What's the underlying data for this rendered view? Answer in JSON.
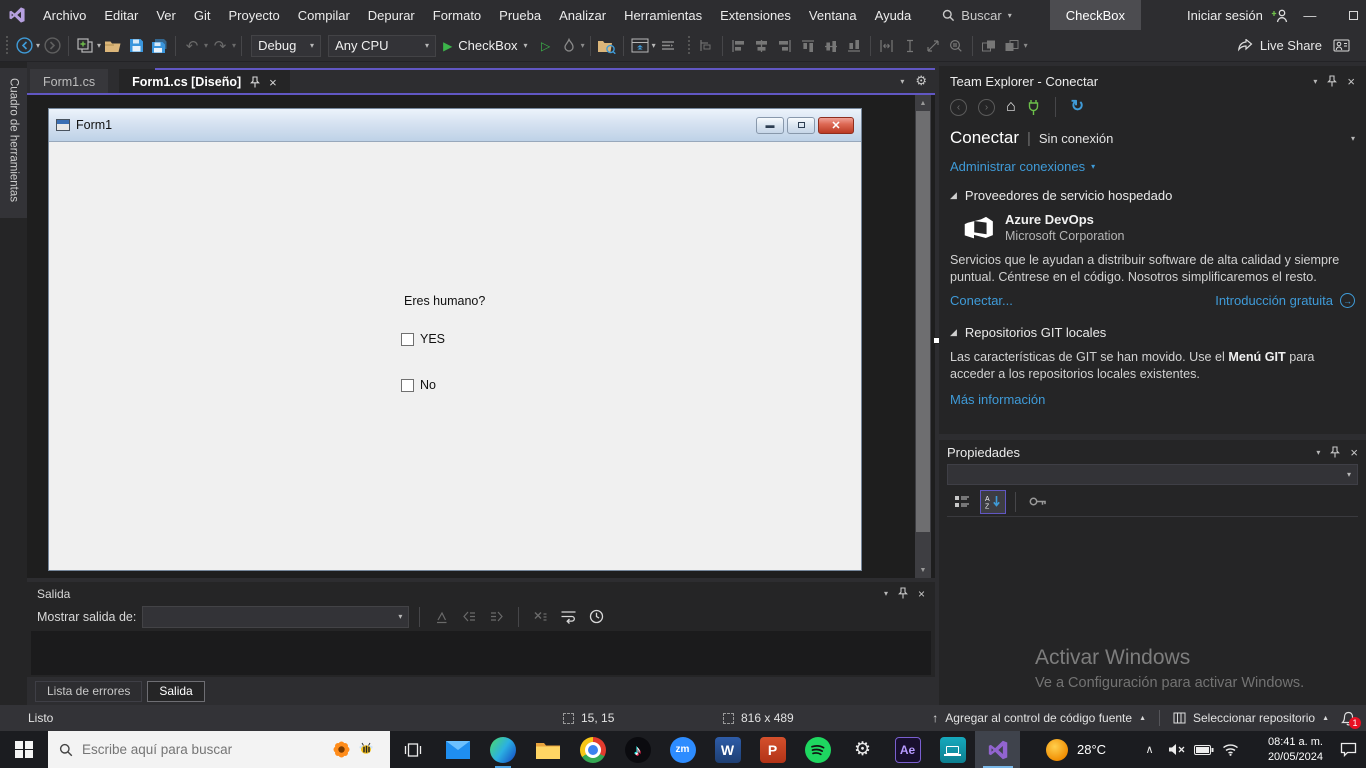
{
  "icons": {
    "search-icon": "magnifier",
    "dropdown-caret": "▾",
    "close-icon": "×",
    "pin-icon": "pushpin",
    "expander-icon": "◢",
    "home-icon": "⌂",
    "refresh-icon": "↻",
    "gear-icon": "⚙",
    "play-icon": "▶",
    "arrow-up-icon": "↑"
  },
  "colors": {
    "accent_purple": "#6157c3",
    "link_blue": "#3f9bd8",
    "run_green": "#3cb44a",
    "form_close_red": "#bb3a24",
    "badge_red": "#e81123",
    "vs_purple": "#9264cf"
  },
  "titlebar": {
    "menus": [
      "Archivo",
      "Editar",
      "Ver",
      "Git",
      "Proyecto",
      "Compilar",
      "Depurar",
      "Formato",
      "Prueba",
      "Analizar",
      "Herramientas",
      "Extensiones",
      "Ventana",
      "Ayuda"
    ],
    "search_label": "Buscar",
    "solution_name": "CheckBox",
    "sign_in_label": "Iniciar sesión"
  },
  "toolbar": {
    "config": "Debug",
    "platform": "Any CPU",
    "run_label": "CheckBox",
    "live_share_label": "Live Share"
  },
  "toolbox": {
    "label": "Cuadro de herramientas"
  },
  "editor": {
    "tabs": [
      {
        "label": "Form1.cs"
      },
      {
        "label": "Form1.cs [Diseño]"
      }
    ],
    "form": {
      "title": "Form1",
      "question": "Eres humano?",
      "option_yes": "YES",
      "option_no": "No"
    }
  },
  "team_explorer": {
    "title": "Team Explorer - Conectar",
    "page": "Conectar",
    "status": "Sin conexión",
    "manage_link": "Administrar conexiones",
    "hosted": {
      "header": "Proveedores de servicio hospedado",
      "name": "Azure DevOps",
      "company": "Microsoft Corporation",
      "description": "Servicios que le ayudan a distribuir software de alta calidad y siempre puntual. Céntrese en el código. Nosotros simplificaremos el resto.",
      "connect_link": "Conectar...",
      "intro_link": "Introducción gratuita"
    },
    "git": {
      "header": "Repositorios GIT locales",
      "text_start": "Las características de GIT se han movido. Use el ",
      "text_bold": "Menú GIT",
      "text_end": " para acceder a los repositorios locales existentes.",
      "more_link": "Más información"
    }
  },
  "properties": {
    "title": "Propiedades"
  },
  "output": {
    "title": "Salida",
    "show_label": "Mostrar salida de:"
  },
  "bottom_tabs": [
    {
      "label": "Lista de errores"
    },
    {
      "label": "Salida"
    }
  ],
  "statusbar": {
    "ready": "Listo",
    "position": "15, 15",
    "size": "816 x 489",
    "source_control": "Agregar al control de código fuente",
    "select_repo": "Seleccionar repositorio",
    "notifications": "1"
  },
  "activation": {
    "line1": "Activar Windows",
    "line2": "Ve a Configuración para activar Windows."
  },
  "taskbar": {
    "search_placeholder": "Escribe aquí para buscar",
    "zoom_label": "zm",
    "word_label": "W",
    "powerpoint_label": "P",
    "ae_label": "Ae",
    "temperature": "28°C",
    "time": "08:41 a. m.",
    "date": "20/05/2024"
  }
}
